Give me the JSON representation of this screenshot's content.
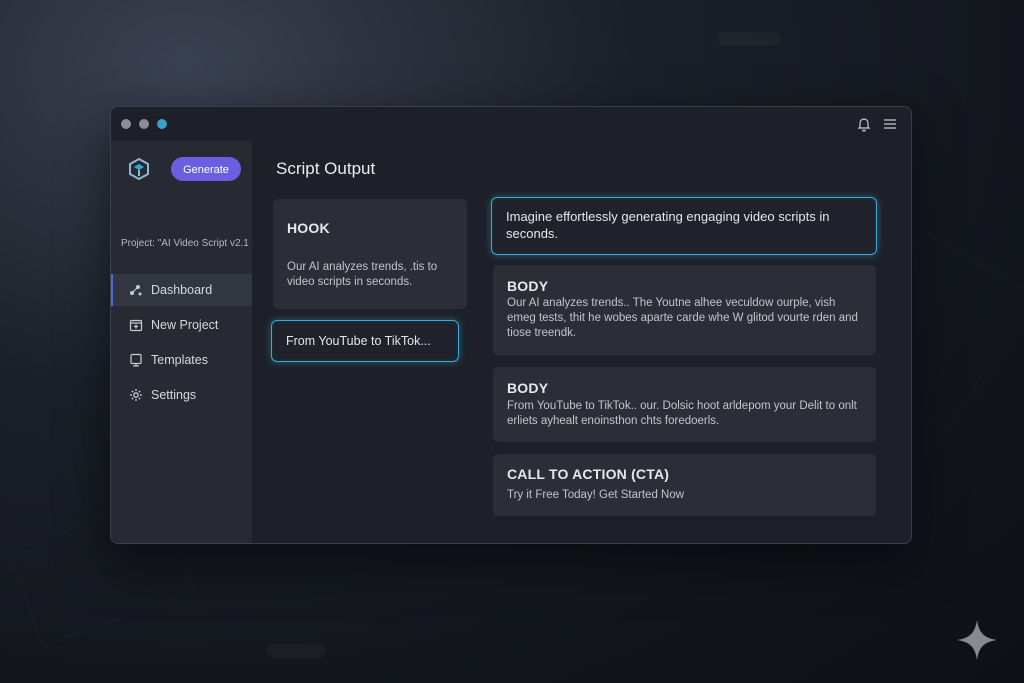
{
  "window": {
    "title_icons": [
      "bell-icon",
      "menu-icon"
    ]
  },
  "sidebar": {
    "generate_label": "Generate",
    "project_label": "Project: \"AI Video Script v2.1",
    "items": [
      {
        "label": "Dashboard",
        "icon": "dashboard-icon",
        "active": true
      },
      {
        "label": "New Project",
        "icon": "new-project-icon",
        "active": false
      },
      {
        "label": "Templates",
        "icon": "templates-icon",
        "active": false
      },
      {
        "label": "Settings",
        "icon": "gear-icon",
        "active": false
      }
    ]
  },
  "main": {
    "title": "Script Output",
    "hook": {
      "title": "HOOK",
      "body": "Our AI analyzes trends, .tis to video scripts in seconds."
    },
    "platform_chip": "From YouTube to TikTok...",
    "highlight": "Imagine effortlessly generating engaging video scripts in seconds.",
    "body1": {
      "title": "BODY",
      "body": "Our AI analyzes trends.. The Youtne alhee veculdow ourple, vish emeg tests, thit he wobes aparte carde whe W glitod vourte rden and tiose treendk."
    },
    "body2": {
      "title": "BODY",
      "body": "From YouTube to TikTok.. our. Dolsic hoot arldepom your Delit to onlt erliets ayhealt enoinsthon chts foredoerls."
    },
    "cta": {
      "title": "CALL TO ACTION (CTA)",
      "body": "Try it Free Today! Get Started Now"
    }
  },
  "colors": {
    "accent": "#6a5fe0",
    "glow": "#3aa8d6",
    "active_dot": "#3aa0c8"
  }
}
